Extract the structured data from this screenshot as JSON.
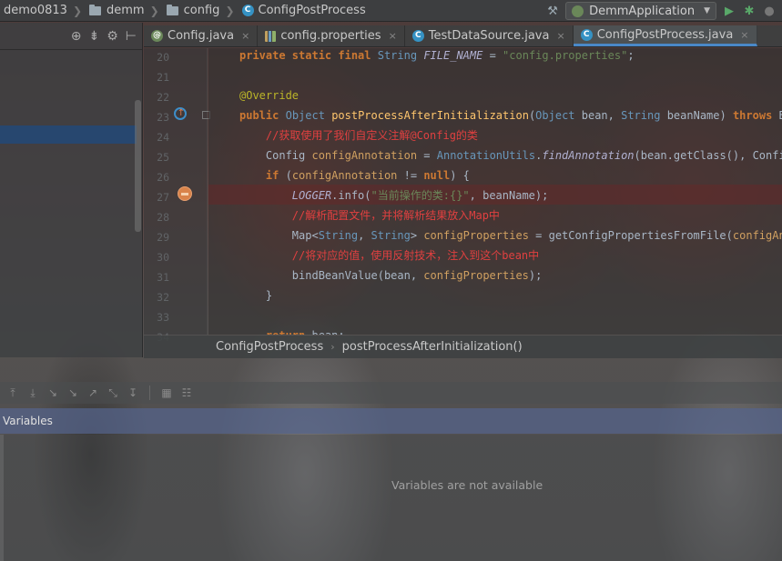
{
  "navbar": {
    "crumbs": [
      {
        "label": "demo0813",
        "icon": "none"
      },
      {
        "label": "demm",
        "icon": "folder-icon"
      },
      {
        "label": "config",
        "icon": "folder-icon"
      },
      {
        "label": "ConfigPostProcess",
        "icon": "class-icon"
      }
    ],
    "run_config": "DemmApplication",
    "icon_run": "▶",
    "icon_debug": "✱"
  },
  "left_toolbar": {
    "icons": [
      "target-icon",
      "collapse-icon",
      "gear-icon",
      "layout-icon"
    ]
  },
  "tabs": [
    {
      "label": "Config.java",
      "icon": "ti-config",
      "glyph": "@",
      "active": false
    },
    {
      "label": "config.properties",
      "icon": "ti-props",
      "glyph": "",
      "active": false
    },
    {
      "label": "TestDataSource.java",
      "icon": "ti-class",
      "glyph": "C",
      "active": false
    },
    {
      "label": "ConfigPostProcess.java",
      "icon": "ti-class",
      "glyph": "C",
      "active": true
    }
  ],
  "tab_close": "×",
  "editor": {
    "line_numbers": [
      "20",
      "21",
      "22",
      "23",
      "24",
      "25",
      "26",
      "27",
      "28",
      "29",
      "30",
      "31",
      "32",
      "33",
      "34"
    ],
    "lines": [
      "<span class=\"kw\">private static final</span> <span class=\"ty\">String</span> <span class=\"it\">FILE_NAME</span> = <span class=\"str\">\"config.properties\"</span>;",
      "",
      "<span class=\"an\">@Override</span>",
      "<span class=\"kw\">public</span> <span class=\"ty\">Object</span> <span class=\"fn\">postProcessAfterInitialization</span>(<span class=\"ty\">Object</span> bean, <span class=\"ty\">String</span> beanName) <span class=\"kw\">throws</span> Be",
      "    <span class=\"cm\">//获取使用了我们自定义注解@Config的类</span>",
      "    Config <span class=\"vr\">configAnnotation</span> = <span class=\"ty\">AnnotationUtils</span>.<span class=\"it\">findAnnotation</span>(bean.getClass(), Config.",
      "    <span class=\"kw\">if</span> (<span class=\"vr\">configAnnotation</span> != <span class=\"kw\">null</span>) {",
      "        <span class=\"it\">LOGGER</span>.info(<span class=\"str\">\"当前操作的类:{}\"</span>, beanName);",
      "        <span class=\"cm\">//解析配置文件，并将解析结果放入Map中</span>",
      "        Map&lt;<span class=\"ty\">String</span>, <span class=\"ty\">String</span>&gt; <span class=\"vr\">configProperties</span> = getConfigPropertiesFromFile(<span class=\"vr\">configAnno</span>",
      "        <span class=\"cm\">//将对应的值，使用反射技术，注入到这个bean中</span>",
      "        bindBeanValue(bean, <span class=\"vr\">configProperties</span>);",
      "    }",
      "",
      "    <span class=\"kw\">return</span> bean;"
    ]
  },
  "editor_breadcrumb": {
    "class_name": "ConfigPostProcess",
    "method_name": "postProcessAfterInitialization()",
    "separator": "›"
  },
  "debug": {
    "variables_title": "Variables",
    "empty_text": "Variables are not available"
  }
}
